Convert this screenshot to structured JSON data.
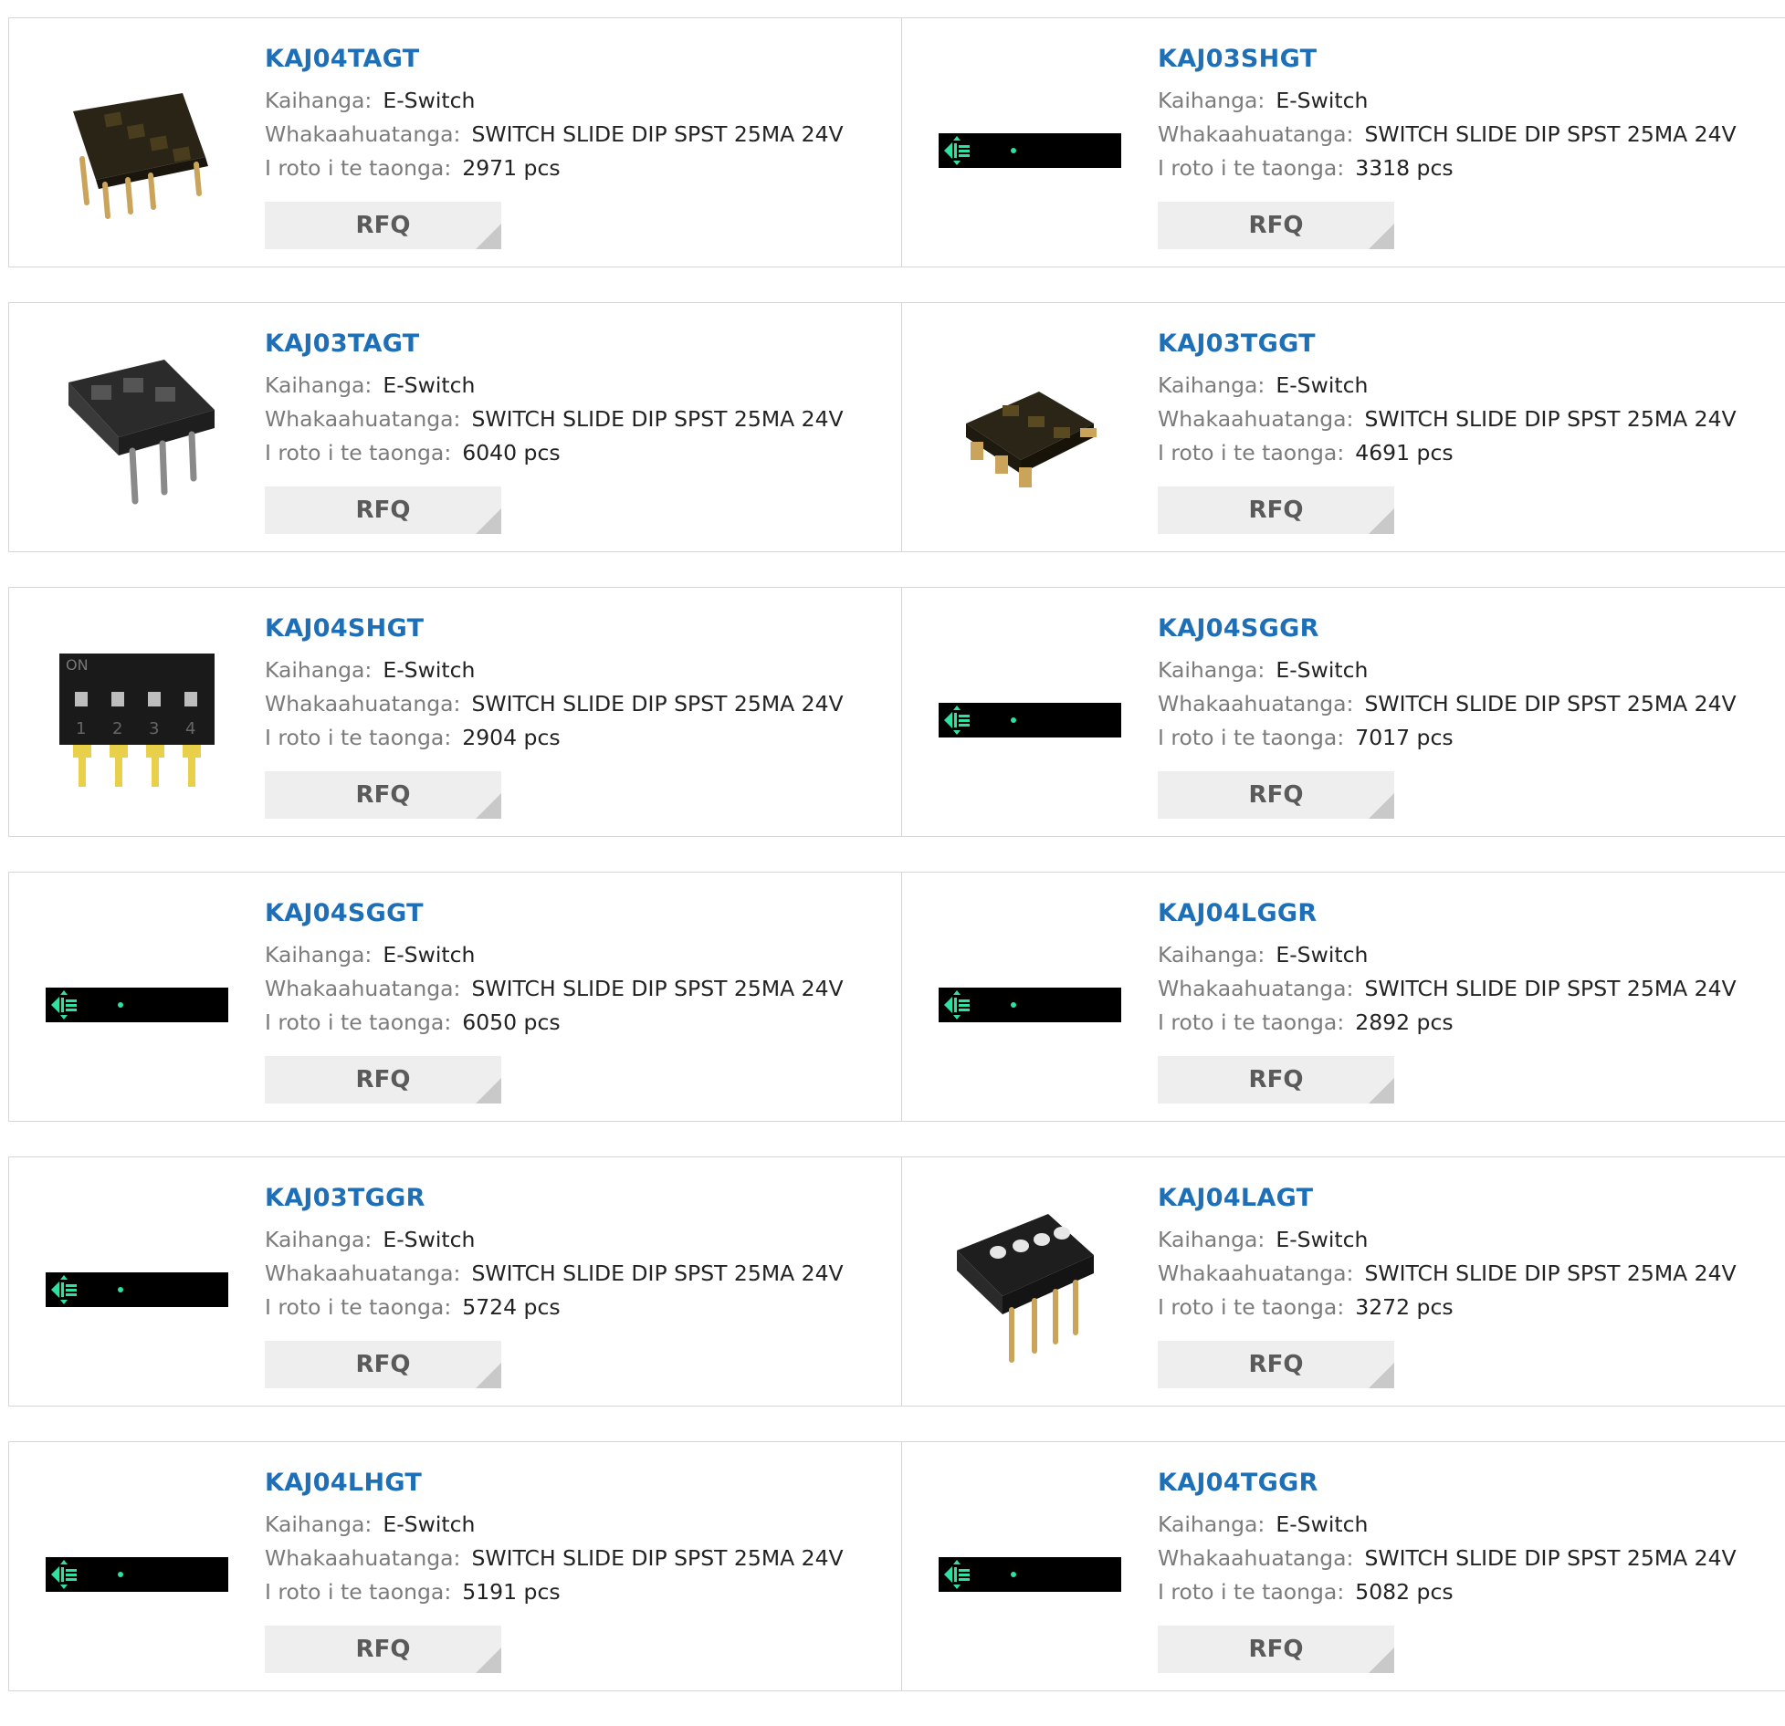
{
  "labels": {
    "manufacturer": "Kaihanga:",
    "description": "Whakaahuatanga:",
    "stock": "I roto i te taonga:",
    "rfq": "RFQ"
  },
  "products": [
    {
      "part": "KAJ04TAGT",
      "manufacturer": "E-Switch",
      "description": "SWITCH SLIDE DIP SPST 25MA 24V",
      "stock": "2971 pcs",
      "image": "dip-4-through-hole"
    },
    {
      "part": "KAJ03SHGT",
      "manufacturer": "E-Switch",
      "description": "SWITCH SLIDE DIP SPST 25MA 24V",
      "stock": "3318 pcs",
      "image": "placeholder-bar"
    },
    {
      "part": "KAJ03TAGT",
      "manufacturer": "E-Switch",
      "description": "SWITCH SLIDE DIP SPST 25MA 24V",
      "stock": "6040 pcs",
      "image": "dip-3-through-hole-gray"
    },
    {
      "part": "KAJ03TGGT",
      "manufacturer": "E-Switch",
      "description": "SWITCH SLIDE DIP SPST 25MA 24V",
      "stock": "4691 pcs",
      "image": "dip-3-smd"
    },
    {
      "part": "KAJ04SHGT",
      "manufacturer": "E-Switch",
      "description": "SWITCH SLIDE DIP SPST 25MA 24V",
      "stock": "2904 pcs",
      "image": "dip-4-black-front"
    },
    {
      "part": "KAJ04SGGR",
      "manufacturer": "E-Switch",
      "description": "SWITCH SLIDE DIP SPST 25MA 24V",
      "stock": "7017 pcs",
      "image": "placeholder-bar"
    },
    {
      "part": "KAJ04SGGT",
      "manufacturer": "E-Switch",
      "description": "SWITCH SLIDE DIP SPST 25MA 24V",
      "stock": "6050 pcs",
      "image": "placeholder-bar"
    },
    {
      "part": "KAJ04LGGR",
      "manufacturer": "E-Switch",
      "description": "SWITCH SLIDE DIP SPST 25MA 24V",
      "stock": "2892 pcs",
      "image": "placeholder-bar"
    },
    {
      "part": "KAJ03TGGR",
      "manufacturer": "E-Switch",
      "description": "SWITCH SLIDE DIP SPST 25MA 24V",
      "stock": "5724 pcs",
      "image": "placeholder-bar"
    },
    {
      "part": "KAJ04LAGT",
      "manufacturer": "E-Switch",
      "description": "SWITCH SLIDE DIP SPST 25MA 24V",
      "stock": "3272 pcs",
      "image": "dip-4-angled"
    },
    {
      "part": "KAJ04LHGT",
      "manufacturer": "E-Switch",
      "description": "SWITCH SLIDE DIP SPST 25MA 24V",
      "stock": "5191 pcs",
      "image": "placeholder-bar"
    },
    {
      "part": "KAJ04TGGR",
      "manufacturer": "E-Switch",
      "description": "SWITCH SLIDE DIP SPST 25MA 24V",
      "stock": "5082 pcs",
      "image": "placeholder-bar"
    }
  ],
  "colors": {
    "link": "#1f6fb7",
    "label": "#7b7b7b",
    "rfq_bg": "#eeeeee",
    "rfq_text": "#5a5a5a",
    "placeholder_icon": "#2fe0a0"
  }
}
